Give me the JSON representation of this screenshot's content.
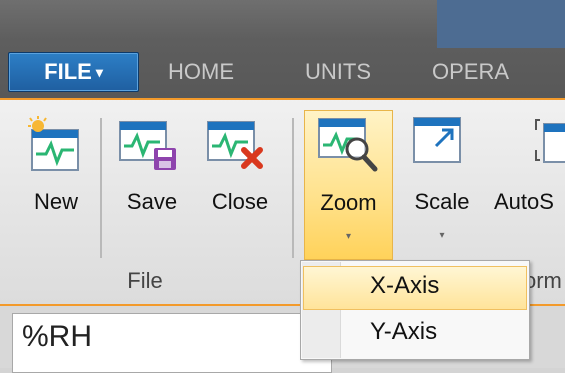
{
  "tabs": {
    "file": "FILE",
    "file_arrow": "▾",
    "home": "HOME",
    "units": "UNITS",
    "operate": "OPERA"
  },
  "ribbon": {
    "buttons": {
      "new": "New",
      "save": "Save",
      "close": "Close",
      "zoom": "Zoom",
      "scale": "Scale",
      "autoscale": "AutoS"
    },
    "dropdown_arrow": "▾",
    "groups": {
      "file": "File",
      "partial": "orm"
    }
  },
  "zoom_menu": {
    "items": [
      "X-Axis",
      "Y-Axis"
    ],
    "highlighted": "X-Axis"
  },
  "field": {
    "value": "%RH"
  },
  "colors": {
    "accent": "#f39a2b",
    "file_tab": "#1f5fa1",
    "highlight": "#ffe18a",
    "graph_line": "#2bb673"
  }
}
